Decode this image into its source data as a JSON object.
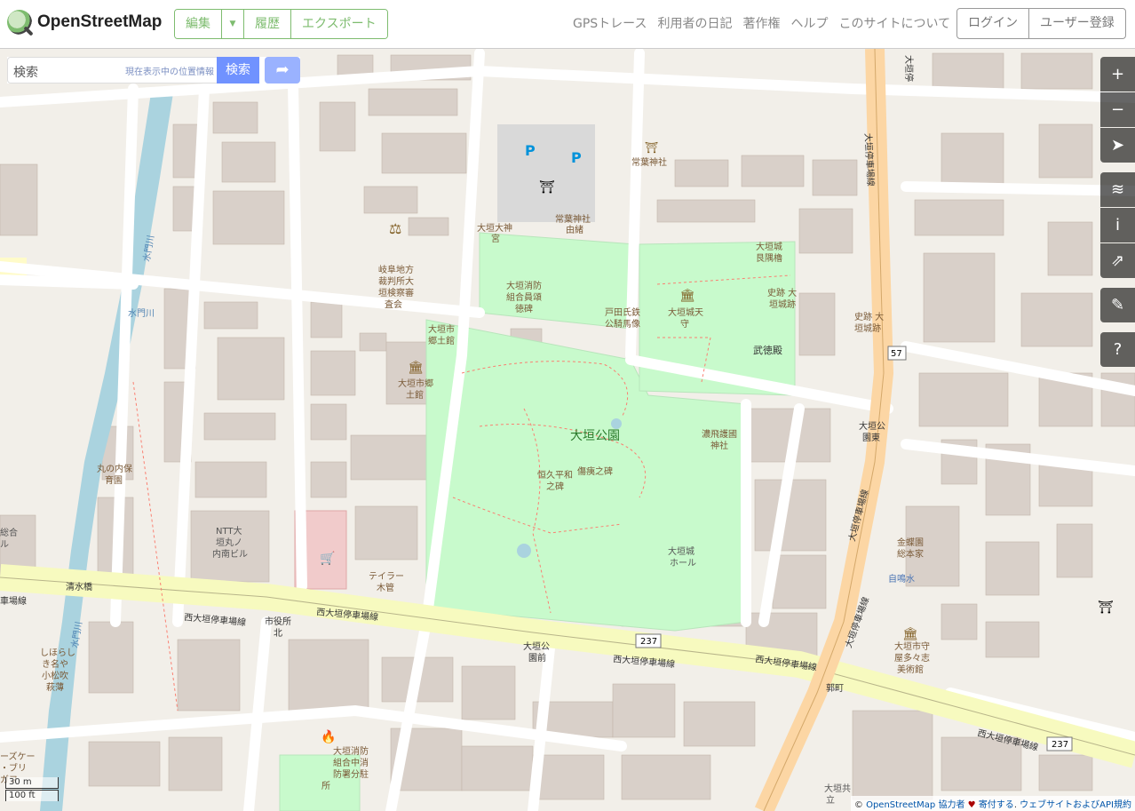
{
  "header": {
    "brand": "OpenStreetMap",
    "edit": "編集",
    "history": "履歴",
    "export": "エクスポート",
    "nav": [
      "GPSトレース",
      "利用者の日記",
      "著作権",
      "ヘルプ",
      "このサイトについて"
    ],
    "login": "ログイン",
    "signup": "ユーザー登録"
  },
  "search": {
    "placeholder": "検索",
    "where_am_i": "現在表示中の位置情報",
    "go": "検索"
  },
  "controls": {
    "zoom_in": "+",
    "zoom_out": "−",
    "locate": "➤",
    "layers": "≋",
    "info": "i",
    "share": "⇗",
    "note": "✎",
    "query": "?"
  },
  "map": {
    "park_name": "大垣公園",
    "labels": {
      "jomo_shrine": "常葉神社",
      "jomo_yui": "常葉神社",
      "jomo_yui2": "由緒",
      "ogaki_shrine": "大垣大神",
      "ogaki_shrine2": "宮",
      "court1": "岐阜地方",
      "court2": "裁判所大",
      "court3": "垣検察審",
      "court4": "査会",
      "fire1": "大垣消防",
      "fire2": "組合員頌",
      "fire3": "徳碑",
      "toda1": "戸田氏鉄",
      "toda2": "公騎馬像",
      "tenshu1": "大垣城天",
      "tenshu2": "守",
      "ushitora1": "大垣城",
      "ushitora2": "艮隅櫓",
      "shiseki1": "史跡 大",
      "shiseki2": "垣城跡",
      "shiseki3": "史跡 大",
      "shiseki4": "垣城跡",
      "butokuden": "武徳殿",
      "kyodokan1": "大垣市",
      "kyodokan2": "郷土館",
      "kyodo3": "大垣市郷",
      "kyodo4": "土館",
      "nohi1": "濃飛護國",
      "nohi2": "神社",
      "heiwa1": "恒久平和",
      "heiwa2": "之碑",
      "shoi": "傷痍之碑",
      "hall1": "大垣城",
      "hall2": "ホール",
      "hoikuen1": "丸の内保",
      "hoikuen2": "育園",
      "ntt1": "NTT大",
      "ntt2": "垣丸ノ",
      "ntt3": "内南ビル",
      "taylor1": "テイラー",
      "taylor2": "木管",
      "shimizu": "清水橋",
      "suimon": "水門川",
      "suimon2": "水門川",
      "suimon3": "水門川",
      "station1": "大垣公",
      "station2": "園前",
      "shiyakusho1": "市役所",
      "shiyakusho2": "北",
      "koen_higashi1": "大垣公",
      "koen_higashi2": "園東",
      "kuruwa": "郭町",
      "kingyo1": "金蝶園",
      "kingyo2": "総本家",
      "jimeisui": "自鳴水",
      "museum1": "大垣市守",
      "museum2": "屋多々志",
      "museum3": "美術館",
      "shimurashi1": "しほらし",
      "shimurashi2": "き名や",
      "shimurashi3": "小松吹",
      "shimurashi4": "萩薄",
      "fire_sub1": "大垣消防",
      "fire_sub2": "組合中消",
      "fire_sub3": "防署分駐",
      "fire_sub4": "所",
      "kyodo_bottom1": "大垣共",
      "kyodo_bottom2": "立",
      "left_ai1": "総合",
      "left_ai2": "ル",
      "left_case1": "ーズケー",
      "left_case2": "・ブリ",
      "left_case3": "ガフ",
      "route": "237",
      "route2": "237",
      "route57": "57",
      "street_w1": "西大垣停車場線",
      "street_w2": "西大垣停車場線",
      "street_w3": "西大垣停車場線",
      "street_w4": "西大垣停車場線",
      "street_w5": "西大垣停車場線",
      "street_n1": "大垣停車場線",
      "street_n2": "大垣停車場線",
      "street_n3": "大垣停車場線",
      "street_n4": "大垣停",
      "street_nw": "車場線"
    }
  },
  "scale": {
    "metric": "30 m",
    "imperial": "100 ft"
  },
  "attribution": {
    "prefix": "©",
    "osm": "OpenStreetMap",
    "contributors": "協力者",
    "heart": "♥",
    "donate": "寄付する",
    "terms": "ウェブサイトおよびAPI規約"
  }
}
